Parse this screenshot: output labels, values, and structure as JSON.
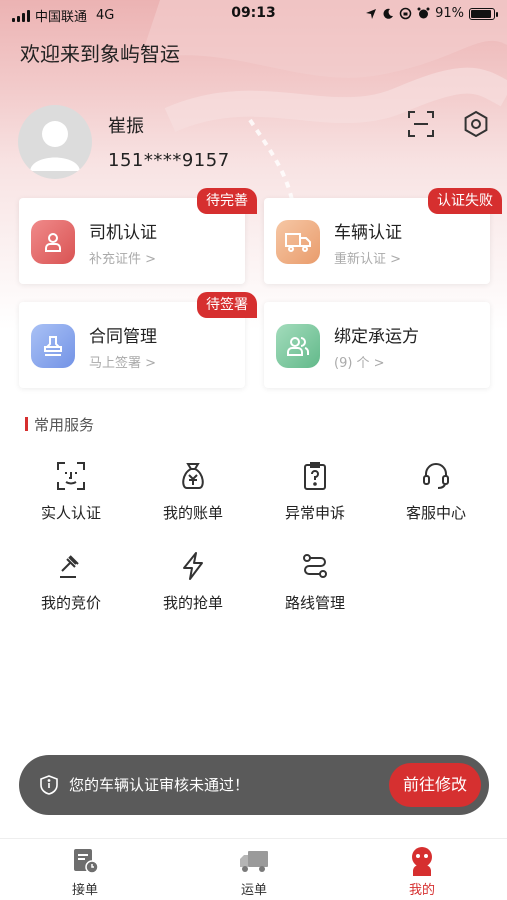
{
  "status_bar": {
    "carrier": "中国联通",
    "network": "4G",
    "time": "09:13",
    "battery": "91%",
    "battery_level": 0.91
  },
  "header": {
    "welcome": "欢迎来到象屿智运",
    "user_name": "崔振",
    "user_phone": "151****9157"
  },
  "cards": [
    {
      "title": "司机认证",
      "subtitle": "补充证件 >",
      "badge": "待完善",
      "icon": "person-icon",
      "color": "#e36a6a"
    },
    {
      "title": "车辆认证",
      "subtitle": "重新认证 >",
      "badge": "认证失败",
      "icon": "truck-icon",
      "color": "#eea77a"
    },
    {
      "title": "合同管理",
      "subtitle": "马上签署 >",
      "badge": "待签署",
      "icon": "stamp-icon",
      "color": "#7f9fea"
    },
    {
      "title": "绑定承运方",
      "subtitle": "(9) 个 >",
      "badge": "",
      "icon": "people-icon",
      "color": "#74c59a"
    }
  ],
  "services": {
    "title": "常用服务",
    "items": [
      {
        "label": "实人认证",
        "icon": "face-scan-icon"
      },
      {
        "label": "我的账单",
        "icon": "money-bag-icon"
      },
      {
        "label": "异常申诉",
        "icon": "clipboard-question-icon"
      },
      {
        "label": "客服中心",
        "icon": "headset-icon"
      },
      {
        "label": "我的竞价",
        "icon": "auction-hammer-icon"
      },
      {
        "label": "我的抢单",
        "icon": "lightning-icon"
      },
      {
        "label": "路线管理",
        "icon": "route-icon"
      }
    ]
  },
  "toast": {
    "message": "您的车辆认证审核未通过！",
    "action": "前往修改"
  },
  "tabs": [
    {
      "label": "接单",
      "icon": "order-icon",
      "active": false
    },
    {
      "label": "运单",
      "icon": "truck-icon",
      "active": false
    },
    {
      "label": "我的",
      "icon": "profile-icon",
      "active": true
    }
  ],
  "colors": {
    "accent": "#d62f2f",
    "toast_bg": "#5a5a5a"
  }
}
